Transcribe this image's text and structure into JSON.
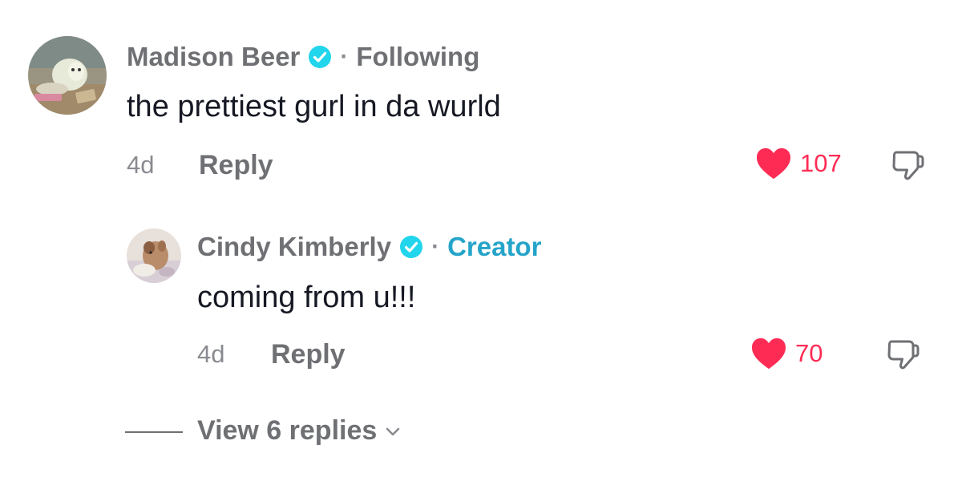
{
  "comment": {
    "username": "Madison Beer",
    "relation": "Following",
    "text": "the prettiest gurl in da wurld",
    "time": "4d",
    "reply_label": "Reply",
    "likes": "107"
  },
  "reply": {
    "username": "Cindy Kimberly",
    "relation": "Creator",
    "text": "coming from u!!!",
    "time": "4d",
    "reply_label": "Reply",
    "likes": "70"
  },
  "view_replies_label": "View 6 replies",
  "colors": {
    "like_red": "#fe2c55",
    "verified_blue": "#20d5ec",
    "creator_blue": "#25a4c9",
    "muted_gray": "#6f7073",
    "text_dark": "#161823"
  },
  "icons": {
    "verified": "verified-badge-icon",
    "like": "heart-icon",
    "dislike": "thumbs-down-icon",
    "expand": "chevron-down-icon"
  }
}
